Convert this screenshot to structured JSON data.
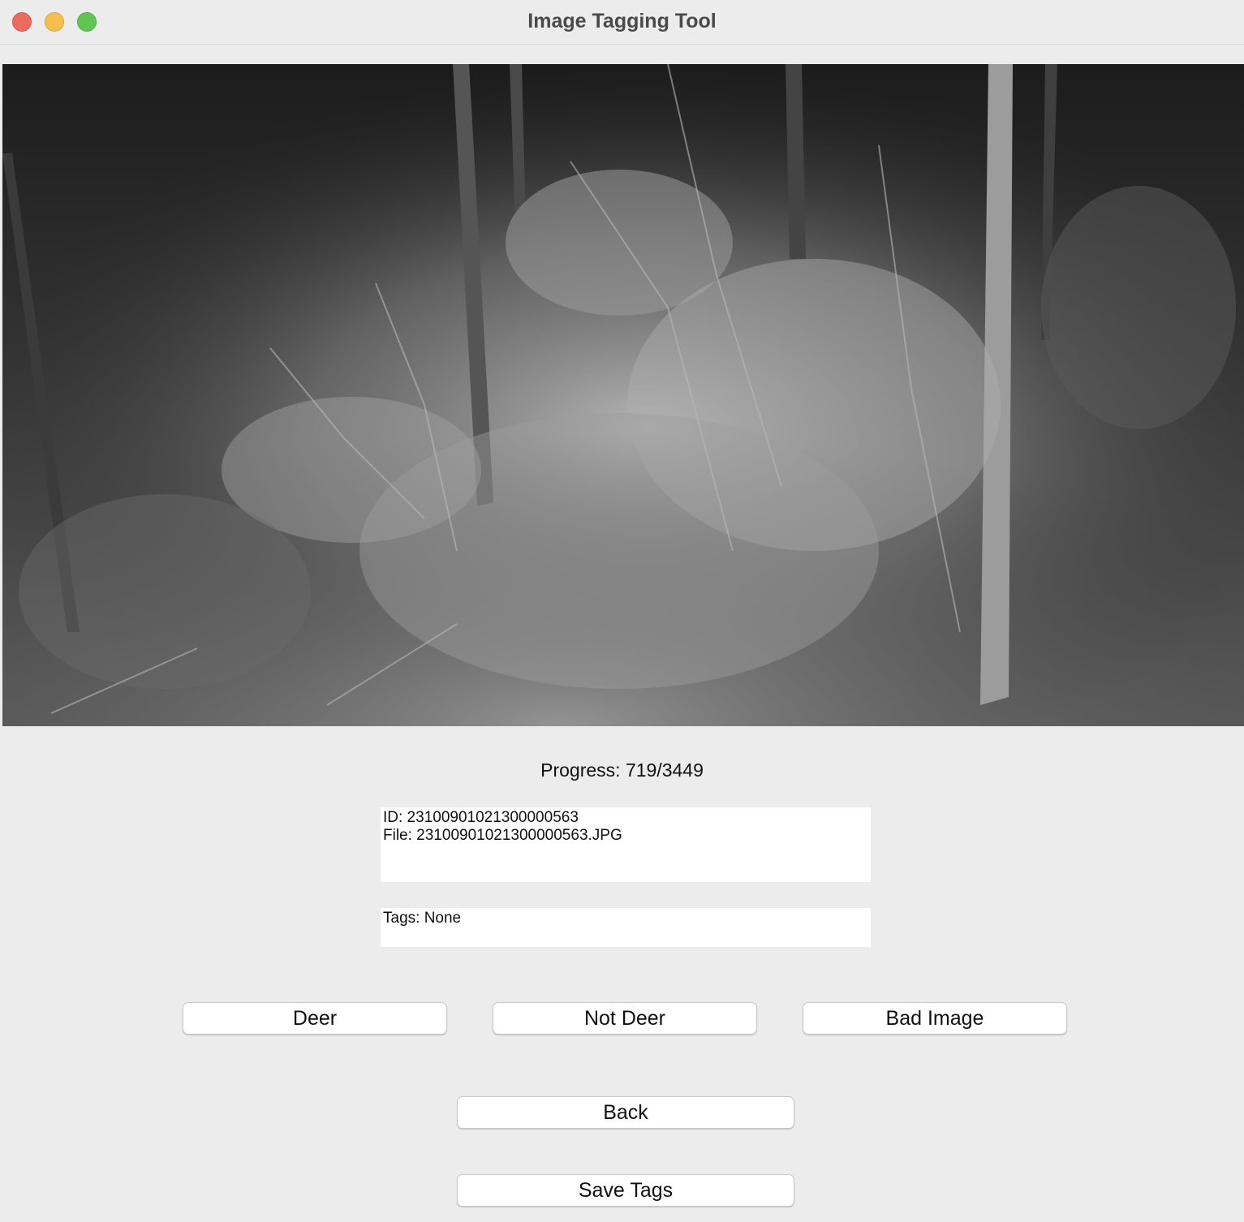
{
  "window": {
    "title": "Image Tagging Tool"
  },
  "image": {
    "icon": "night-trail-camera-photo"
  },
  "progress": {
    "text": "Progress: 719/3449",
    "current": 719,
    "total": 3449
  },
  "info": {
    "id_line": "ID: 23100901021300000563",
    "file_line": "File: 23100901021300000563.JPG"
  },
  "tags": {
    "line": "Tags: None"
  },
  "buttons": {
    "deer": "Deer",
    "not_deer": "Not Deer",
    "bad_image": "Bad Image",
    "back": "Back",
    "save": "Save Tags"
  },
  "colors": {
    "close": "#ed6a5e",
    "minimize": "#f5bf4f",
    "maximize": "#61c554",
    "background": "#ececec"
  }
}
